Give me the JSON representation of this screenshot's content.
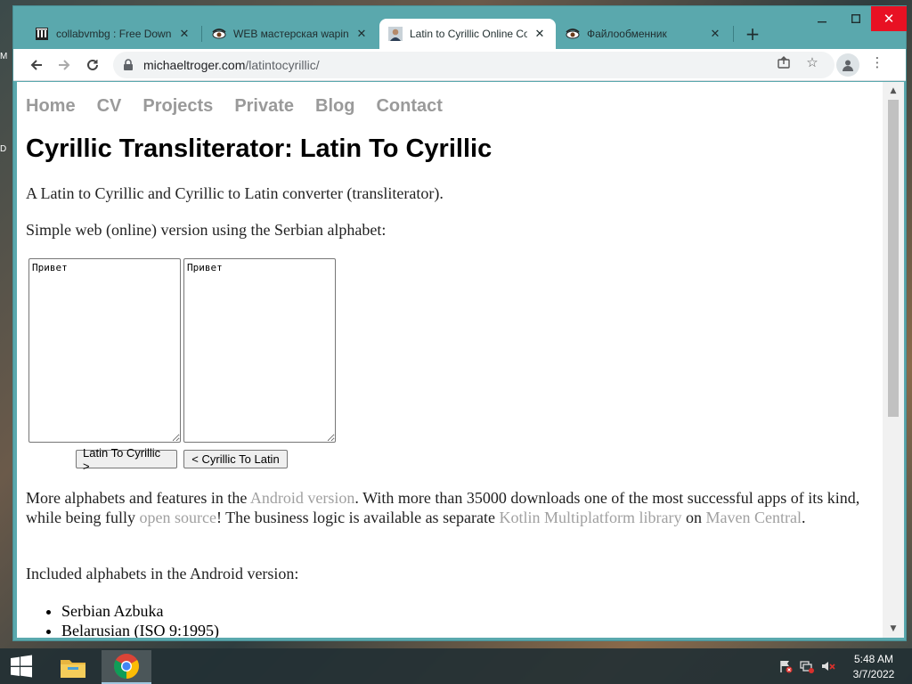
{
  "desktop": {
    "edge_letters": [
      "M",
      "D"
    ]
  },
  "browser": {
    "tabs": [
      {
        "title": "collabvmbg : Free Downl",
        "favicon": "library-icon"
      },
      {
        "title": "WEB мастерская wapinet",
        "favicon": "eye-icon"
      },
      {
        "title": "Latin to Cyrillic Online Co",
        "favicon": "person-icon",
        "active": true
      },
      {
        "title": "Файлообменник",
        "favicon": "eye-icon"
      }
    ],
    "url_host": "michaeltroger.com",
    "url_path": "/latintocyrillic/"
  },
  "page": {
    "nav": [
      "Home",
      "CV",
      "Projects",
      "Private",
      "Blog",
      "Contact"
    ],
    "title": "Cyrillic Transliterator: Latin To Cyrillic",
    "intro": "A Latin to Cyrillic and Cyrillic to Latin converter (transliterator).",
    "simple": "Simple web (online) version using the Serbian alphabet:",
    "latin_input": "Привет",
    "cyrillic_input": "Привет",
    "btn_to_cyrillic": "Latin To Cyrillic >",
    "btn_to_latin": "< Cyrillic To Latin",
    "more": {
      "t1": "More alphabets and features in the ",
      "l1": "Android version",
      "t2": ". With more than 35000 downloads one of the most successful apps of its kind, while being fully ",
      "l2": "open source",
      "t3": "! The business logic is available as separate ",
      "l3": "Kotlin Multiplatform library",
      "t4": " on ",
      "l4": "Maven Central",
      "t5": "."
    },
    "included": "Included alphabets in the Android version:",
    "alphabets": [
      "Serbian Azbuka",
      "Belarusian (ISO 9:1995)"
    ]
  },
  "taskbar": {
    "time": "5:48 AM",
    "date": "3/7/2022"
  }
}
